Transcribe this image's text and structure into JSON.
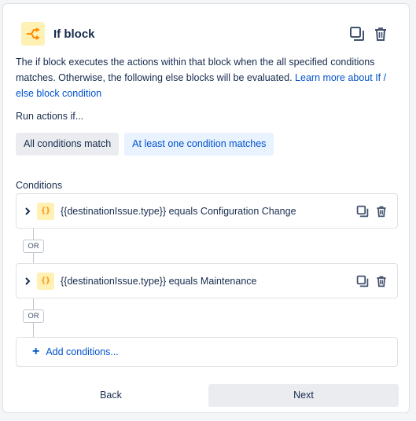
{
  "block": {
    "title": "If block",
    "icon": "branch-icon",
    "accent": "#ff8b00"
  },
  "description": {
    "text": "The if block executes the actions within that block when the all specified conditions matches. Otherwise, the following else blocks will be evaluated. ",
    "link_text": "Learn more about If / else block condition"
  },
  "run_actions": {
    "label": "Run actions if...",
    "options": [
      "All conditions match",
      "At least one condition matches"
    ],
    "selected": "At least one condition matches"
  },
  "conditions": {
    "label": "Conditions",
    "items": [
      {
        "text": "{{destinationIssue.type}} equals Configuration Change",
        "icon_text": "{}"
      },
      {
        "text": "{{destinationIssue.type}} equals Maintenance",
        "icon_text": "{}"
      }
    ],
    "separator": "OR",
    "add_label": "Add conditions..."
  },
  "footer": {
    "back_label": "Back",
    "next_label": "Next"
  }
}
